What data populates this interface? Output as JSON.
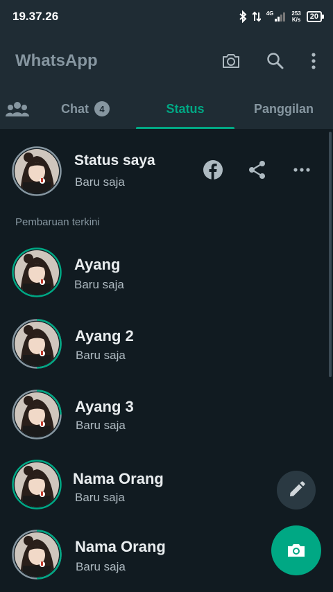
{
  "status_bar": {
    "time": "19.37.26",
    "network": "4G",
    "speed_value": "253",
    "speed_unit": "K/s",
    "battery": "20"
  },
  "app": {
    "title": "WhatsApp"
  },
  "tabs": {
    "chat_label": "Chat",
    "chat_badge": "4",
    "status_label": "Status",
    "calls_label": "Panggilan"
  },
  "my_status": {
    "name": "Status saya",
    "time": "Baru saja"
  },
  "section_label": "Pembaruan terkini",
  "updates": [
    {
      "name": "Ayang",
      "time": "Baru saja"
    },
    {
      "name": "Ayang 2",
      "time": "Baru saja"
    },
    {
      "name": "Ayang 3",
      "time": "Baru saja"
    },
    {
      "name": "Nama Orang",
      "time": "Baru saja"
    },
    {
      "name": "Nama Orang",
      "time": "Baru saja"
    }
  ],
  "colors": {
    "accent": "#00a884",
    "background": "#111b21",
    "bar": "#1f2c34",
    "muted": "#8696a0"
  },
  "icons": [
    "camera-icon",
    "search-icon",
    "more-vert-icon",
    "community-icon",
    "facebook-icon",
    "share-icon",
    "more-horiz-icon",
    "pencil-icon",
    "camera-fab-icon"
  ]
}
